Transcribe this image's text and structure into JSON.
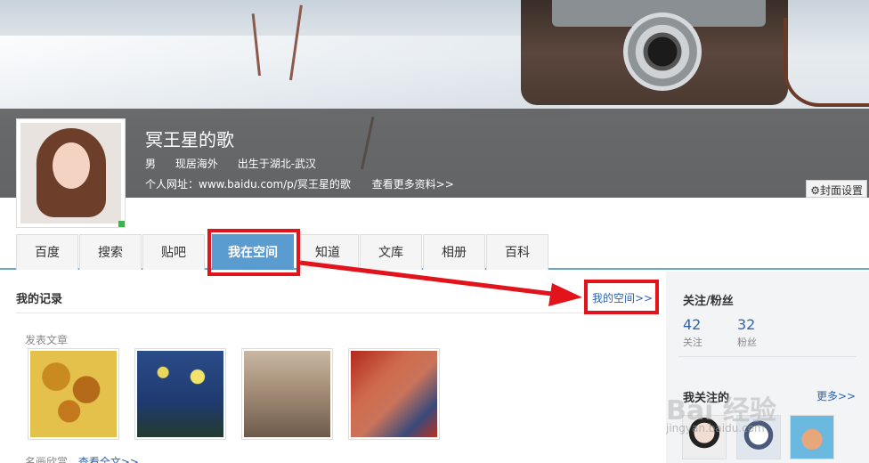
{
  "profile": {
    "name": "冥王星的歌",
    "gender": "男",
    "residence": "现居海外",
    "birthplace": "出生于湖北-武汉",
    "url_text": "个人网址：www.baidu.com/p/冥王星的歌",
    "more_info": "查看更多资料>>",
    "cover_settings": "封面设置"
  },
  "tabs": [
    {
      "label": "百度"
    },
    {
      "label": "搜索"
    },
    {
      "label": "贴吧"
    },
    {
      "label": "我在空间",
      "active": true
    },
    {
      "label": "知道"
    },
    {
      "label": "文库"
    },
    {
      "label": "相册"
    },
    {
      "label": "百科"
    }
  ],
  "main": {
    "section_title": "我的记录",
    "my_space_link": "我的空间>>",
    "articles_label": "发表文章",
    "thumbnails": [
      {
        "name": "sunflowers-thumbnail"
      },
      {
        "name": "starry-night-thumbnail"
      },
      {
        "name": "school-of-athens-thumbnail"
      },
      {
        "name": "les-demoiselles-thumbnail"
      }
    ],
    "famous_paintings_label": "名画欣赏",
    "view_full_text": "查看全文>>"
  },
  "sidebar": {
    "title": "关注/粉丝",
    "following_count": "42",
    "following_label": "关注",
    "fans_count": "32",
    "fans_label": "粉丝",
    "followed_title": "我关注的",
    "more": "更多>>"
  },
  "watermark": {
    "text": "Bai 经验",
    "url": "jingyan.baidu.com"
  },
  "colors": {
    "accent": "#5a9bd0",
    "highlight": "#e3131b",
    "link": "#2d64b3"
  }
}
